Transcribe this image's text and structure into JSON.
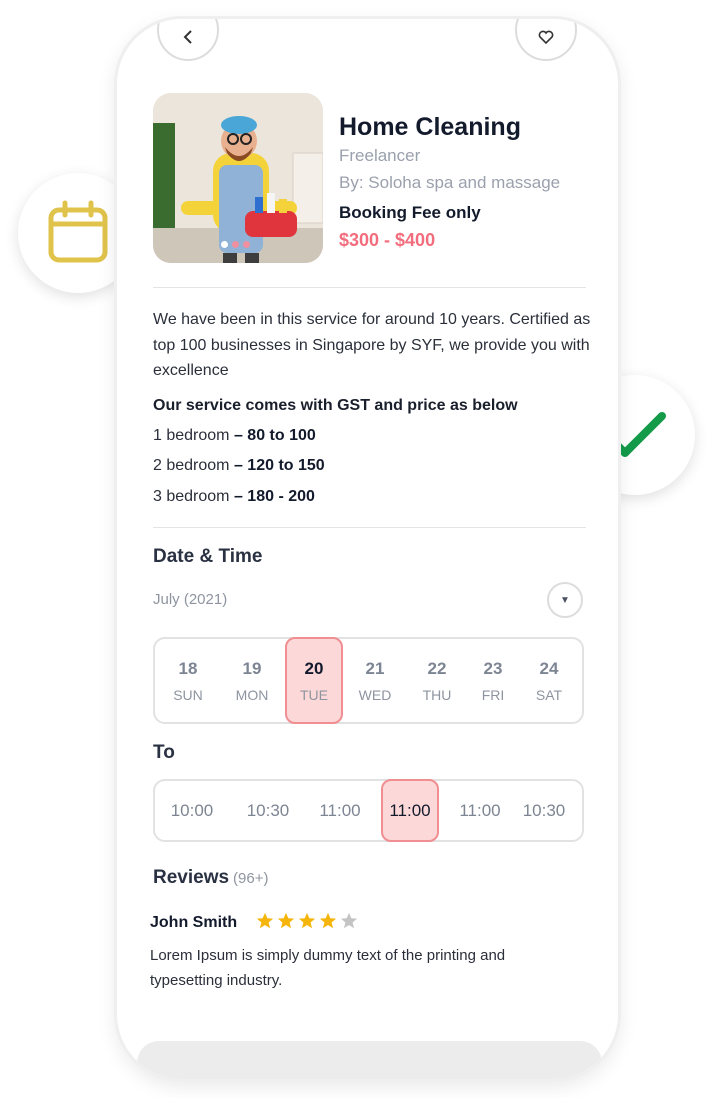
{
  "listing": {
    "title": "Home Cleaning",
    "subtitle": "Freelancer",
    "byline": "By: Soloha spa and massage",
    "fee_label": "Booking Fee only",
    "price_range": "$300 - $400"
  },
  "description": {
    "intro": "We have been in this service for around 10 years. Certified as top 100 businesses in Singapore by SYF, we provide you with excellence",
    "service_head": "Our service comes with GST and price as below",
    "rates": [
      {
        "label": "1 bedroom",
        "price": "– 80 to 100"
      },
      {
        "label": "2 bedroom",
        "price": "– 120 to 150"
      },
      {
        "label": "3 bedroom",
        "price": "– 180 - 200"
      }
    ]
  },
  "date_time": {
    "title": "Date & Time",
    "month": "July (2021)",
    "month_toggle_icon": "chevron-down-icon",
    "days": [
      {
        "num": "18",
        "name": "SUN",
        "selected": false
      },
      {
        "num": "19",
        "name": "MON",
        "selected": false
      },
      {
        "num": "20",
        "name": "TUE",
        "selected": true
      },
      {
        "num": "21",
        "name": "WED",
        "selected": false
      },
      {
        "num": "22",
        "name": "THU",
        "selected": false
      },
      {
        "num": "23",
        "name": "FRI",
        "selected": false
      },
      {
        "num": "24",
        "name": "SAT",
        "selected": false
      }
    ]
  },
  "to": {
    "title": "To",
    "slots": [
      {
        "time": "10:00",
        "selected": false
      },
      {
        "time": "10:30",
        "selected": false
      },
      {
        "time": "11:00",
        "selected": false
      },
      {
        "time": "11:00",
        "selected": true
      },
      {
        "time": "11:00",
        "selected": false
      },
      {
        "time": "10:30",
        "selected": false
      }
    ]
  },
  "reviews": {
    "title": "Reviews",
    "count": "(96+)",
    "items": [
      {
        "name": "John Smith",
        "rating": 4,
        "max_rating": 5,
        "text": "Lorem Ipsum is simply dummy text of the printing and typesetting industry."
      }
    ]
  },
  "badges": {
    "calendar_icon": "calendar-icon",
    "check_icon": "checkmark-icon"
  },
  "colors": {
    "accent": "#f26d7d",
    "selected_bg": "#fcd8d8",
    "selected_border": "#f08e92",
    "star": "#f5b50a",
    "star_empty": "#c4c4c4",
    "calendar": "#e0c34b",
    "check": "#139b4a"
  }
}
